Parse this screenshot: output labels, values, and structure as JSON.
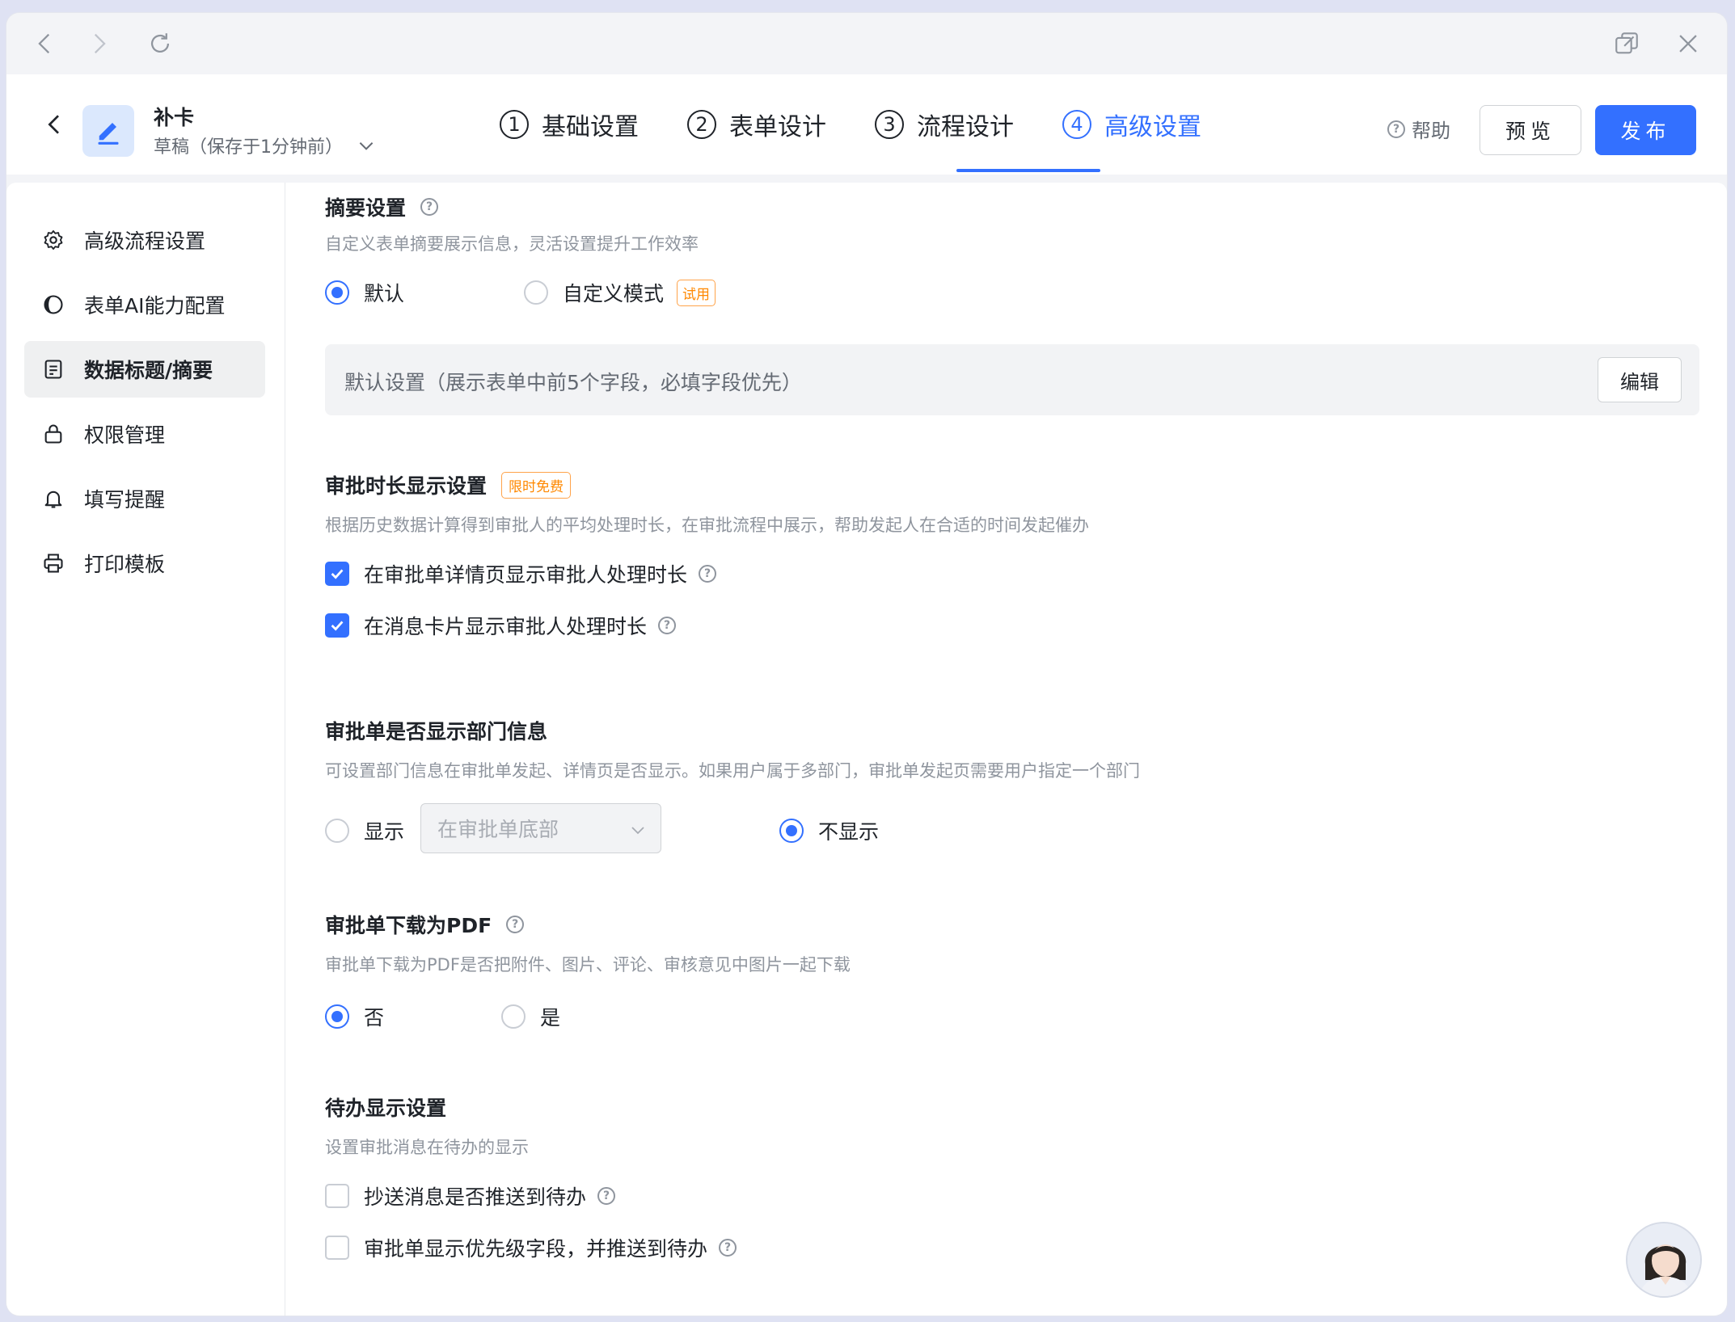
{
  "header": {
    "form_name": "补卡",
    "form_status": "草稿（保存于1分钟前）",
    "steps": [
      {
        "num": "1",
        "label": "基础设置"
      },
      {
        "num": "2",
        "label": "表单设计"
      },
      {
        "num": "3",
        "label": "流程设计"
      },
      {
        "num": "4",
        "label": "高级设置"
      }
    ],
    "help": "帮助",
    "preview": "预览",
    "publish": "发布"
  },
  "sidebar": {
    "items": [
      {
        "label": "高级流程设置",
        "icon": "gear-icon"
      },
      {
        "label": "表单AI能力配置",
        "icon": "ai-icon"
      },
      {
        "label": "数据标题/摘要",
        "icon": "document-icon",
        "active": true
      },
      {
        "label": "权限管理",
        "icon": "lock-icon"
      },
      {
        "label": "填写提醒",
        "icon": "bell-icon"
      },
      {
        "label": "打印模板",
        "icon": "printer-icon"
      }
    ]
  },
  "summary": {
    "title": "摘要设置",
    "desc": "自定义表单摘要展示信息，灵活设置提升工作效率",
    "opt_default": "默认",
    "opt_custom": "自定义模式",
    "tag_trial": "试用",
    "box_text": "默认设置（展示表单中前5个字段，必填字段优先）",
    "edit": "编辑"
  },
  "duration": {
    "title": "审批时长显示设置",
    "tag": "限时免费",
    "desc": "根据历史数据计算得到审批人的平均处理时长，在审批流程中展示，帮助发起人在合适的时间发起催办",
    "check1": "在审批单详情页显示审批人处理时长",
    "check2": "在消息卡片显示审批人处理时长"
  },
  "department": {
    "title": "审批单是否显示部门信息",
    "desc": "可设置部门信息在审批单发起、详情页是否显示。如果用户属于多部门，审批单发起页需要用户指定一个部门",
    "opt_show": "显示",
    "select_value": "在审批单底部",
    "opt_hide": "不显示"
  },
  "pdf": {
    "title": "审批单下载为PDF",
    "desc": "审批单下载为PDF是否把附件、图片、评论、审核意见中图片一起下载",
    "opt_no": "否",
    "opt_yes": "是"
  },
  "todo": {
    "title": "待办显示设置",
    "desc": "设置审批消息在待办的显示",
    "check1": "抄送消息是否推送到待办",
    "check2": "审批单显示优先级字段，并推送到待办"
  },
  "colors": {
    "accent": "#3370ff",
    "tag": "#ff8800"
  }
}
